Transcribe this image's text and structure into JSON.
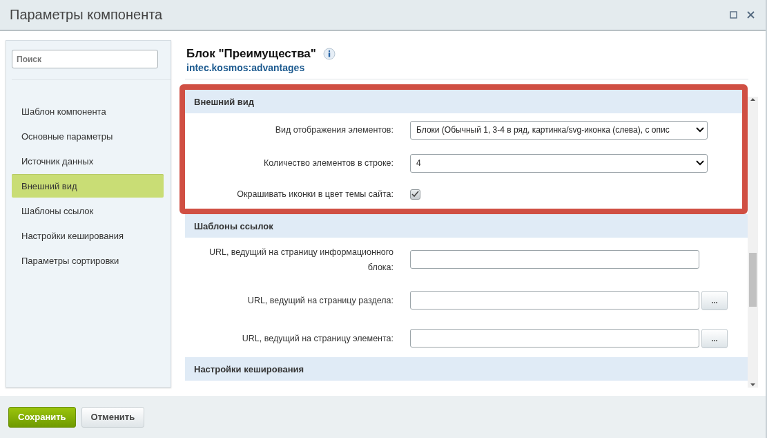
{
  "window": {
    "title": "Параметры компонента"
  },
  "sidebar": {
    "search": {
      "placeholder": "Поиск"
    },
    "items": [
      {
        "label": "Шаблон компонента",
        "selected": false
      },
      {
        "label": "Основные параметры",
        "selected": false
      },
      {
        "label": "Источник данных",
        "selected": false
      },
      {
        "label": "Внешний вид",
        "selected": true
      },
      {
        "label": "Шаблоны ссылок",
        "selected": false
      },
      {
        "label": "Настройки кеширования",
        "selected": false
      },
      {
        "label": "Параметры сортировки",
        "selected": false
      }
    ]
  },
  "header": {
    "title": "Блок \"Преимущества\"",
    "code": "intec.kosmos:advantages"
  },
  "sections": [
    {
      "title": "Внешний вид",
      "highlighted": true,
      "rows": [
        {
          "kind": "select",
          "label": "Вид отображения элементов:",
          "value": "Блоки (Обычный 1, 3-4 в ряд, картинка/svg-иконка (слева), с опис"
        },
        {
          "kind": "select",
          "label": "Количество элементов в строке:",
          "value": "4"
        },
        {
          "kind": "checkbox",
          "label": "Окрашивать иконки в цвет темы сайта:",
          "checked": true
        }
      ]
    },
    {
      "title": "Шаблоны ссылок",
      "highlighted": false,
      "rows": [
        {
          "kind": "text",
          "label": "URL, ведущий на страницу информационного блока:"
        },
        {
          "kind": "text",
          "label": "URL, ведущий на страницу раздела:",
          "browse_label": "..."
        },
        {
          "kind": "text",
          "label": "URL, ведущий на страницу элемента:",
          "browse_label": "..."
        }
      ]
    },
    {
      "title": "Настройки кеширования",
      "highlighted": false
    }
  ],
  "buttons": [
    {
      "label": "Сохранить",
      "kind": "primary"
    },
    {
      "label": "Отменить",
      "kind": "secondary"
    }
  ]
}
